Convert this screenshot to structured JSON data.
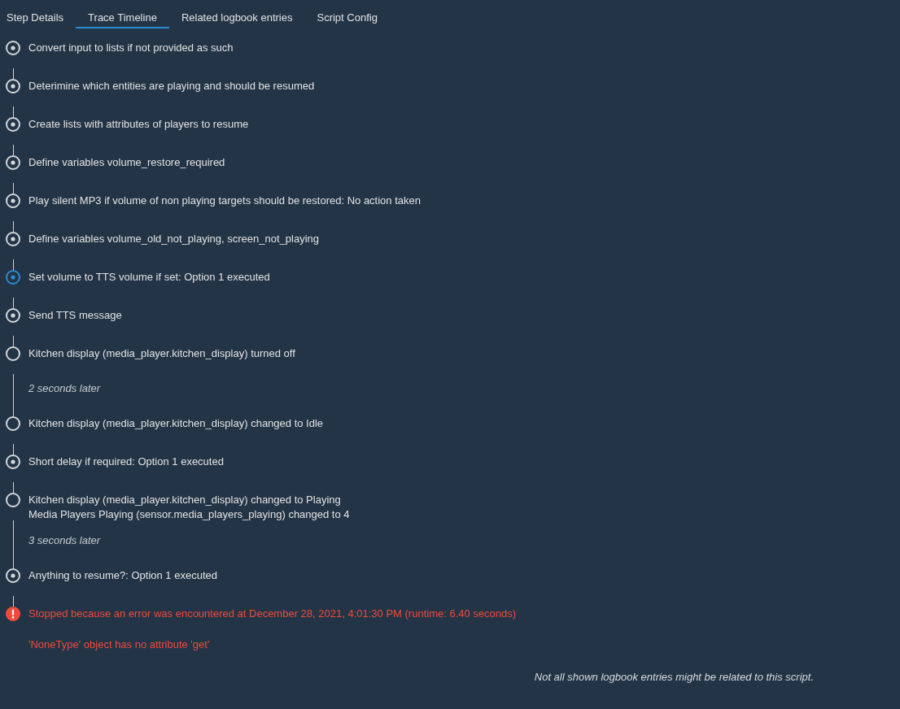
{
  "tabs": [
    {
      "label": "Step Details",
      "selected": false
    },
    {
      "label": "Trace Timeline",
      "selected": true
    },
    {
      "label": "Related logbook entries",
      "selected": false
    },
    {
      "label": "Script Config",
      "selected": false
    }
  ],
  "timeline": [
    {
      "kind": "step",
      "selected": false,
      "lines": [
        "Convert input to lists if not provided as such"
      ]
    },
    {
      "kind": "step",
      "selected": false,
      "lines": [
        "Deterimine which entities are playing and should be resumed"
      ]
    },
    {
      "kind": "step",
      "selected": false,
      "lines": [
        "Create lists with attributes of players to resume"
      ]
    },
    {
      "kind": "step",
      "selected": false,
      "lines": [
        "Define variables volume_restore_required"
      ]
    },
    {
      "kind": "step",
      "selected": false,
      "lines": [
        "Play silent MP3 if volume of non playing targets should be restored: No action taken"
      ]
    },
    {
      "kind": "step",
      "selected": false,
      "lines": [
        "Define variables volume_old_not_playing, screen_not_playing"
      ]
    },
    {
      "kind": "step",
      "selected": true,
      "lines": [
        "Set volume to TTS volume if set: Option 1 executed"
      ]
    },
    {
      "kind": "step",
      "selected": false,
      "lines": [
        "Send TTS message"
      ]
    },
    {
      "kind": "event",
      "selected": false,
      "lines": [
        "Kitchen display (media_player.kitchen_display) turned off"
      ],
      "later": "2 seconds later"
    },
    {
      "kind": "event",
      "selected": false,
      "lines": [
        "Kitchen display (media_player.kitchen_display) changed to Idle"
      ]
    },
    {
      "kind": "step",
      "selected": false,
      "lines": [
        "Short delay if required: Option 1 executed"
      ]
    },
    {
      "kind": "event",
      "selected": false,
      "lines": [
        "Kitchen display (media_player.kitchen_display) changed to Playing",
        "Media Players Playing (sensor.media_players_playing) changed to 4"
      ],
      "later": "3 seconds later"
    },
    {
      "kind": "step",
      "selected": false,
      "lines": [
        "Anything to resume?: Option 1 executed"
      ]
    },
    {
      "kind": "error",
      "selected": false,
      "lines": [
        "Stopped because an error was encountered at December 28, 2021, 4:01:30 PM (runtime: 6.40 seconds)"
      ],
      "detail": "'NoneType' object has no attribute 'get'"
    }
  ],
  "note": "Not all shown logbook entries might be related to this script."
}
